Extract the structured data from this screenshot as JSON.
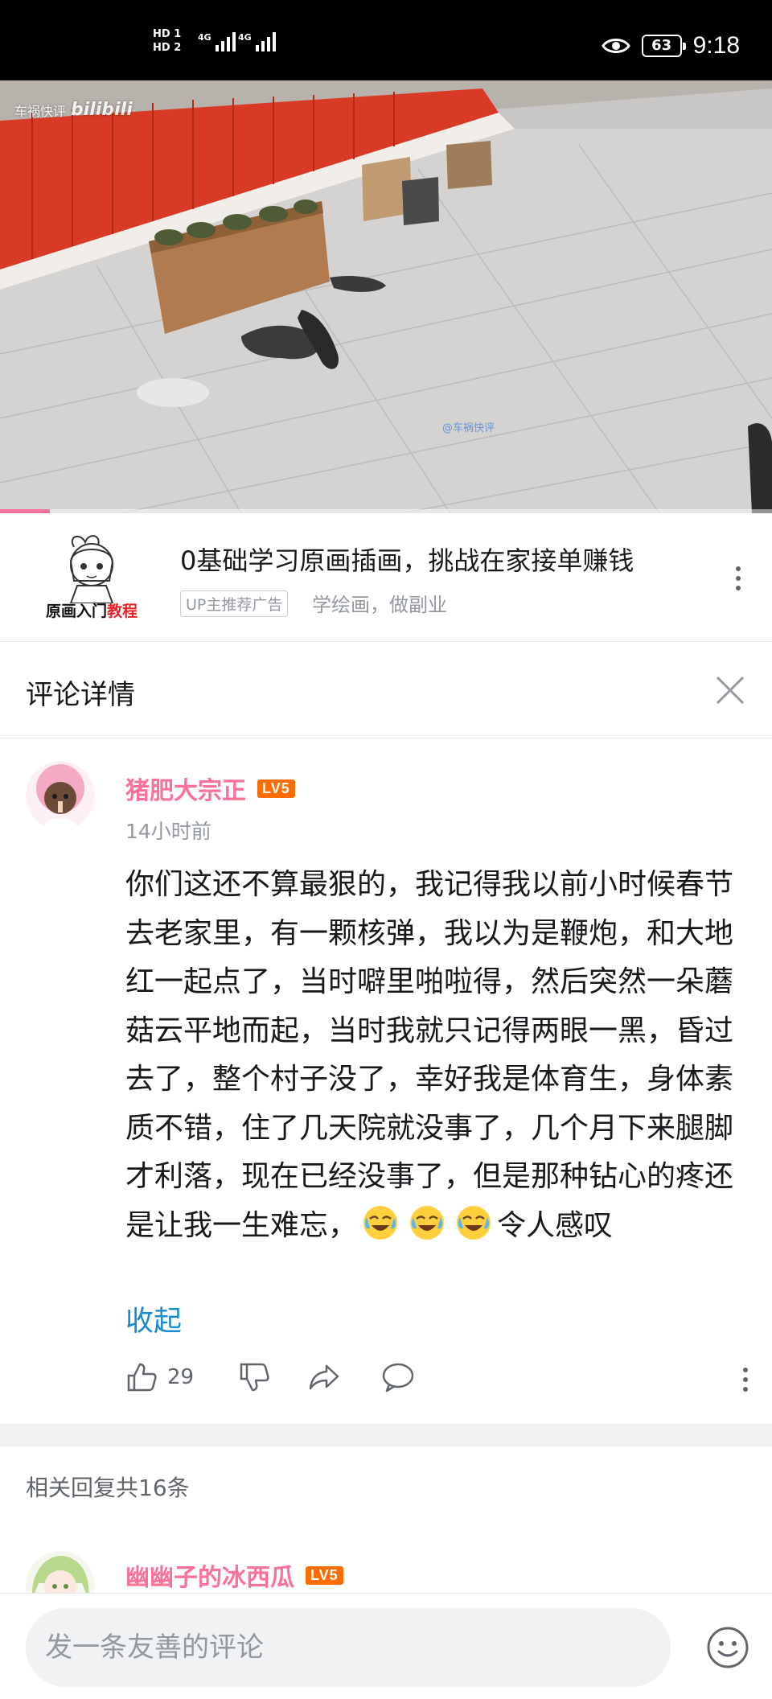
{
  "status_bar": {
    "sim1": "HD 1",
    "sim2": "HD 2",
    "net1": "4G",
    "net2": "4G",
    "battery": "63",
    "time": "9:18",
    "icons": [
      "signal-icon",
      "eye-icon",
      "battery-icon"
    ]
  },
  "video": {
    "channel_label": "车祸快评",
    "platform_logo": "bilibili",
    "progress": 0.065
  },
  "ad": {
    "logo_text_1": "原画入门",
    "logo_text_2": "教程",
    "title": "0基础学习原画插画，挑战在家接单赚钱",
    "tag": "UP主推荐广告",
    "subtitle": "学绘画，做副业"
  },
  "panel": {
    "title": "评论详情"
  },
  "main_comment": {
    "username": "猪肥大宗正",
    "level": "LV5",
    "time": "14小时前",
    "text": "你们这还不算最狠的，我记得我以前小时候春节去老家里，有一颗核弹，我以为是鞭炮，和大地红一起点了，当时噼里啪啦得，然后突然一朵蘑菇云平地而起，当时我就只记得两眼一黑，昏过去了，整个村子没了，幸好我是体育生，身体素质不错，住了几天院就没事了，几个月下来腿脚才利落，现在已经没事了，但是那种钻心的疼还是让我一生难忘，",
    "text_tail": "令人感叹",
    "collapse_label": "收起",
    "like_count": "29"
  },
  "replies": {
    "count_label": "相关回复共16条",
    "first_reply": {
      "username": "幽幽子的冰西瓜",
      "level": "LV5"
    }
  },
  "input": {
    "placeholder": "发一条友善的评论"
  },
  "colors": {
    "accent_pink": "#fb7299",
    "level_orange": "#ff6c00",
    "link_blue": "#178bcf",
    "gray_text": "#9499a0"
  }
}
